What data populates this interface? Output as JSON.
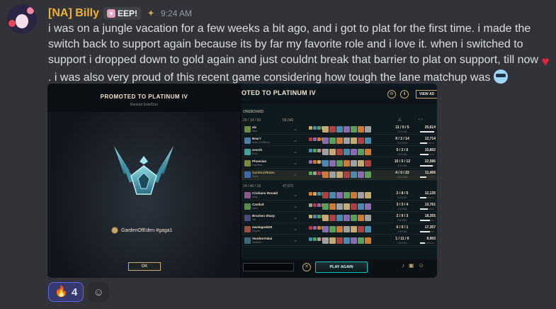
{
  "message": {
    "username": "[NA] Billy",
    "tag_label": "EEP!",
    "timestamp": "9:24 AM",
    "text_part1": "i was on a jungle vacation for a few weeks a bit ago, and i got to plat for the first time. i made the switch back to support again because its by far my favorite role and i love it. when i switched to support i dropped down to gold again and just couldnt break that barrier to plat on support, till now",
    "text_part2": ". i was also very proud of this recent game considering how tough the lane matchup was",
    "emoji_heart": "heart-emoji",
    "emoji_cool": "sunglasses-emoji"
  },
  "attachment": {
    "promo": {
      "title": "PROMOTED TO PLATINUM IV",
      "subtitle": "Ranked Solo/Duo",
      "player": "GardenOfEden #gaga1",
      "ok_label": "OK"
    },
    "scoreboard": {
      "title": "OTED TO PLATINUM IV",
      "meta": "...",
      "view_label": "VIEW AD",
      "section_label": "OREBOARD",
      "team1": {
        "score": "29 / 14 / 59",
        "gold": "58,045"
      },
      "team2": {
        "score": "14 / 40 / 19",
        "gold": "47,972"
      },
      "players": [
        {
          "name": "alc",
          "champ": "Illaoi",
          "kda": "11 / 5 / 5",
          "ratio": "3.2 KDA",
          "dmg": "25,614",
          "dmg_ratio": 1.0,
          "color": "#6a8c3c"
        },
        {
          "name": "Bear?",
          "champ": "Nunu & Willump",
          "kda": "9 / 2 / 14",
          "ratio": "11.5 KDA",
          "dmg": "12,714",
          "dmg_ratio": 0.5,
          "color": "#4a7ea8"
        },
        {
          "name": "zeverk",
          "champ": "Ekko",
          "kda": "5 / 2 / 6",
          "ratio": "5.5 KDA",
          "dmg": "15,802",
          "dmg_ratio": 0.62,
          "color": "#3fa0a0"
        },
        {
          "name": "Phoenian",
          "champ": "Kog'Maw",
          "kda": "10 / 5 / 12",
          "ratio": "4.4 KDA",
          "dmg": "22,586",
          "dmg_ratio": 0.88,
          "color": "#7a8a3a"
        },
        {
          "name": "GardenOfEden",
          "champ": "Sona",
          "kda": "4 / 0 / 22",
          "ratio": "26.0 KDA",
          "dmg": "11,466",
          "dmg_ratio": 0.45,
          "color": "#3a6ab0",
          "highlight": true
        },
        {
          "name": "Cristiano Ronald",
          "champ": "Irelia",
          "kda": "2 / 8 / 5",
          "ratio": "0.9 KDA",
          "dmg": "12,135",
          "dmg_ratio": 0.47,
          "color": "#8a5a8a"
        },
        {
          "name": "Cantlsd",
          "champ": "Ivern",
          "kda": "3 / 3 / 4",
          "ratio": "2.3 KDA",
          "dmg": "13,761",
          "dmg_ratio": 0.54,
          "color": "#5a8a4a"
        },
        {
          "name": "Brocken Sharp",
          "champ": "Vex",
          "kda": "2 / 9 / 3",
          "ratio": "0.6 KDA",
          "dmg": "18,355",
          "dmg_ratio": 0.72,
          "color": "#4a4a7a"
        },
        {
          "name": "swolegod420",
          "champ": "Draven",
          "kda": "6 / 9 / 1",
          "ratio": "0.8 KDA",
          "dmg": "17,357",
          "dmg_ratio": 0.68,
          "color": "#a04a3a"
        },
        {
          "name": "VoodooYokai",
          "champ": "Nautilus",
          "kda": "1 / 11 / 6",
          "ratio": "0.6 KDA",
          "dmg": "8,903",
          "dmg_ratio": 0.35,
          "color": "#3a6a7a"
        }
      ],
      "play_again_label": "PLAY AGAIN"
    }
  },
  "reactions": {
    "fire": {
      "icon": "fire-emoji",
      "count": "4"
    },
    "add_icon": "add-reaction-icon"
  }
}
